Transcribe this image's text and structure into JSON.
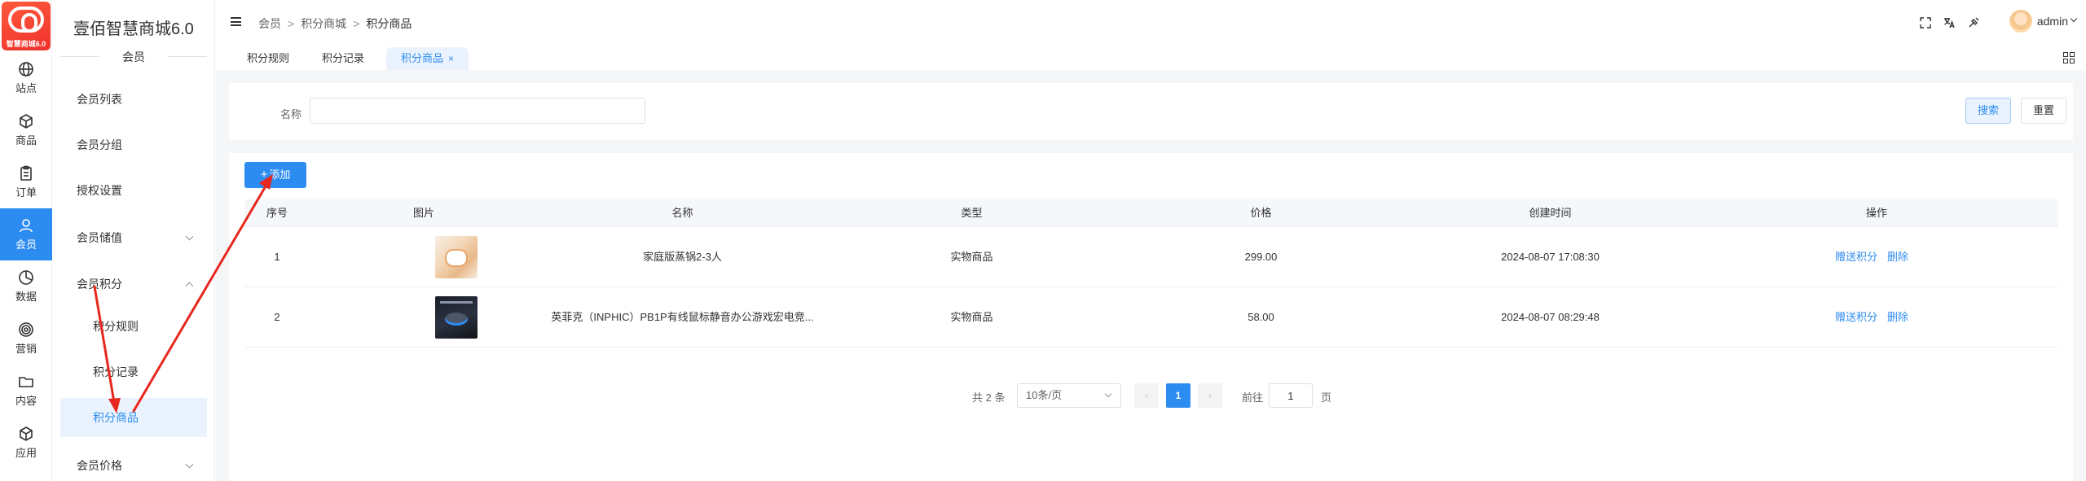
{
  "logo": {
    "text": "智慧商城6.0"
  },
  "rail": [
    {
      "label": "站点",
      "icon": "globe-icon"
    },
    {
      "label": "商品",
      "icon": "box-icon"
    },
    {
      "label": "订单",
      "icon": "clipboard-icon"
    },
    {
      "label": "会员",
      "icon": "user-icon",
      "active": true
    },
    {
      "label": "数据",
      "icon": "pie-chart-icon"
    },
    {
      "label": "营销",
      "icon": "target-icon"
    },
    {
      "label": "内容",
      "icon": "folder-icon"
    },
    {
      "label": "应用",
      "icon": "cube-icon"
    }
  ],
  "submenu": {
    "brand": "壹佰智慧商城6.0",
    "section": "会员",
    "items": [
      {
        "label": "会员列表"
      },
      {
        "label": "会员分组"
      },
      {
        "label": "授权设置"
      },
      {
        "label": "会员储值"
      },
      {
        "label": "会员积分"
      },
      {
        "label": "积分规则"
      },
      {
        "label": "积分记录"
      },
      {
        "label": "积分商品"
      },
      {
        "label": "会员价格"
      }
    ]
  },
  "header": {
    "breadcrumb": [
      "会员",
      "积分商城",
      "积分商品"
    ],
    "separator": ">",
    "icons": [
      "fullscreen-icon",
      "translate-icon",
      "theme-icon"
    ],
    "user": "admin"
  },
  "tabs": [
    {
      "label": "积分规则"
    },
    {
      "label": "积分记录"
    },
    {
      "label": "积分商品",
      "active": true,
      "close": "×"
    }
  ],
  "search": {
    "label": "名称",
    "value": "",
    "placeholder": "",
    "search_button": "搜索",
    "reset_button": "重置"
  },
  "toolbar": {
    "add_button": "添加",
    "add_icon": "+"
  },
  "table": {
    "columns": [
      "序号",
      "图片",
      "名称",
      "类型",
      "价格",
      "创建时间",
      "操作"
    ],
    "rows": [
      {
        "index": "1",
        "image": "steamer-pot-thumbnail",
        "name": "家庭版蒸锅2-3人",
        "type": "实物商品",
        "price": "299.00",
        "created": "2024-08-07 17:08:30",
        "actions": [
          "赠送积分",
          "删除"
        ]
      },
      {
        "index": "2",
        "image": "mouse-thumbnail",
        "name": "英菲克（INPHIC）PB1P有线鼠标静音办公游戏宏电竞...",
        "type": "实物商品",
        "price": "58.00",
        "created": "2024-08-07 08:29:48",
        "actions": [
          "赠送积分",
          "删除"
        ]
      }
    ]
  },
  "pagination": {
    "total": "共 2 条",
    "page_size": "10条/页",
    "prev": "‹",
    "current": "1",
    "next": "›",
    "goto_label": "前往",
    "goto_value": "1",
    "page_label": "页"
  },
  "colors": {
    "primary": "#2d8cf0",
    "annotation": "#e8271e"
  }
}
